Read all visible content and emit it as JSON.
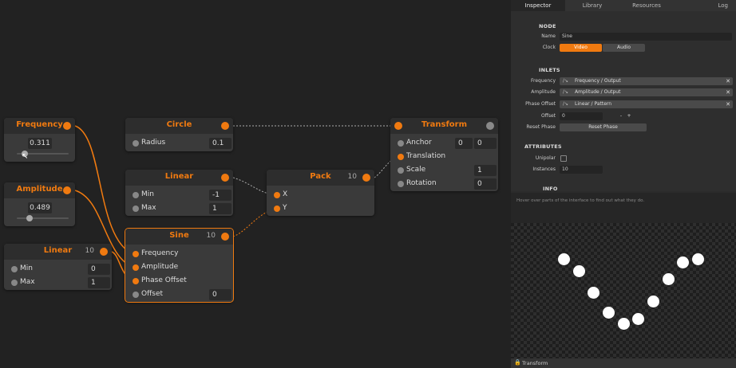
{
  "nodes": {
    "frequency": {
      "title": "Frequency",
      "value": "0.311",
      "slider_level": 0.16
    },
    "amplitude": {
      "title": "Amplitude",
      "value": "0.489",
      "slider_level": 0.25
    },
    "linear_left": {
      "title": "Linear",
      "count": "10",
      "rows": [
        {
          "label": "Min",
          "value": "0"
        },
        {
          "label": "Max",
          "value": "1"
        }
      ]
    },
    "circle": {
      "title": "Circle",
      "rows": [
        {
          "label": "Radius",
          "value": "0.1"
        }
      ]
    },
    "linear_mid": {
      "title": "Linear",
      "rows": [
        {
          "label": "Min",
          "value": "-1"
        },
        {
          "label": "Max",
          "value": "1"
        }
      ]
    },
    "sine": {
      "title": "Sine",
      "count": "10",
      "rows": [
        {
          "label": "Frequency"
        },
        {
          "label": "Amplitude"
        },
        {
          "label": "Phase Offset"
        },
        {
          "label": "Offset",
          "value": "0"
        }
      ]
    },
    "pack": {
      "title": "Pack",
      "count": "10",
      "rows": [
        {
          "label": "X"
        },
        {
          "label": "Y"
        }
      ]
    },
    "transform": {
      "title": "Transform",
      "rows": [
        {
          "label": "Anchor",
          "value": "0",
          "value2": "0"
        },
        {
          "label": "Translation"
        },
        {
          "label": "Scale",
          "value": "1"
        },
        {
          "label": "Rotation",
          "value": "0"
        }
      ]
    }
  },
  "panel": {
    "tabs": [
      "Inspector",
      "Library",
      "Resources",
      "Log"
    ],
    "node_section": "NODE",
    "name_label": "Name",
    "name_value": "Sine",
    "clock_label": "Clock",
    "clock_options": [
      "Video",
      "Audio"
    ],
    "inlets_section": "INLETS",
    "inlets": [
      {
        "label": "Frequency",
        "connection": "Frequency / Output"
      },
      {
        "label": "Amplitude",
        "connection": "Amplitude / Output"
      },
      {
        "label": "Phase Offset",
        "connection": "Linear / Pattern"
      }
    ],
    "offset_label": "Offset",
    "offset_value": "0",
    "offset_minus": "-",
    "offset_plus": "+",
    "reset_label": "Reset Phase",
    "reset_button": "Reset Phase",
    "attributes_section": "ATTRIBUTES",
    "unipolar_label": "Unipolar",
    "instances_label": "Instances",
    "instances_value": "10",
    "info_section": "INFO",
    "hint": "Hover over parts of the interface to find out what they do.",
    "status": "Transform"
  },
  "colors": {
    "accent": "#f07a10",
    "background": "#222222",
    "node": "#3a3a3a",
    "panel": "#2b2b2b"
  },
  "icons": {
    "connection": "connection-icon",
    "remove": "close-icon",
    "lock": "lock-icon",
    "cursor": "cursor-icon"
  }
}
